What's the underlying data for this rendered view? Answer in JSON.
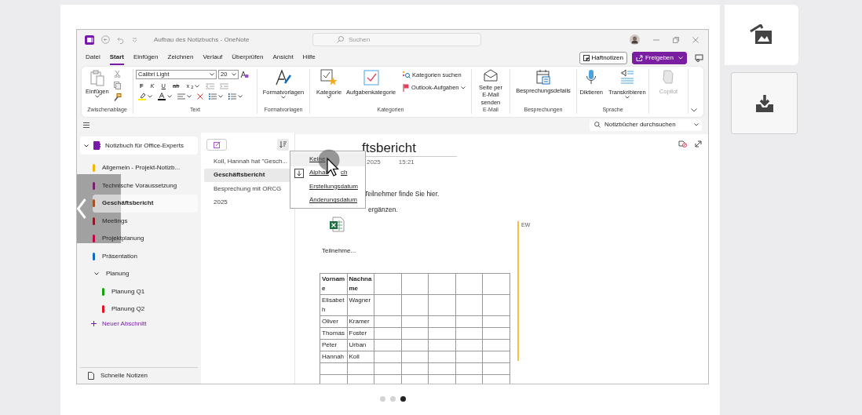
{
  "window": {
    "title": "Aufbau des Notizbuchs  -  OneNote",
    "search_placeholder": "Suchen"
  },
  "menu_tabs": [
    {
      "label": "Datei",
      "selected": false
    },
    {
      "label": "Start",
      "selected": true
    },
    {
      "label": "Einfügen",
      "selected": false
    },
    {
      "label": "Zeichnen",
      "selected": false
    },
    {
      "label": "Verlauf",
      "selected": false
    },
    {
      "label": "Überprüfen",
      "selected": false
    },
    {
      "label": "Ansicht",
      "selected": false
    },
    {
      "label": "Hilfe",
      "selected": false
    }
  ],
  "header_buttons": {
    "sticky_notes": "Haftnotizen",
    "share": "Freigeben"
  },
  "ribbon": {
    "clipboard": {
      "paste": "Einfügen",
      "label": "Zwischenablage"
    },
    "text": {
      "font": "Calibri Light",
      "size": "20",
      "bold": "F",
      "italic": "K",
      "underline": "U",
      "strikethrough": "ab",
      "subscript": "x$_{2}$",
      "label": "Text"
    },
    "styles": {
      "button": "Formatvorlagen",
      "label": "Formatvorlagen"
    },
    "tags": {
      "tag": "Kategorie",
      "todo": "Aufgabenkategorie",
      "find": "Kategorien suchen",
      "outlook": "Outlook-Aufgaben",
      "label": "Kategorien"
    },
    "email": {
      "button": "Seite per E-Mail senden",
      "label": "E-Mail"
    },
    "meetings": {
      "button": "Besprechungsdetails",
      "label": "Besprechungen"
    },
    "voice": {
      "dictate": "Diktieren",
      "transcribe": "Transkribieren",
      "label": "Sprache"
    },
    "copilot": {
      "label": "Copilot",
      "disabled": true
    }
  },
  "toolbar": {
    "search_placeholder": "Notizbücher durchsuchen"
  },
  "sidebar": {
    "notebook": "Notizbuch für Office-Experts",
    "sections": [
      {
        "label": "Allgemein - Projekt-Notizb...",
        "color": "#f4b400",
        "selected": false
      },
      {
        "label": "Technische Voraussetzung",
        "color": "#7a1f6e",
        "selected": false
      },
      {
        "label": "Geschäftsbericht",
        "color": "#a35220",
        "selected": true
      },
      {
        "label": "Meetings",
        "color": "#8c1c2c",
        "selected": false
      },
      {
        "label": "Projektplanung",
        "color": "#c8004a",
        "selected": false
      },
      {
        "label": "Präsentation",
        "color": "#0f6cbd",
        "selected": false
      },
      {
        "label": "Planung",
        "expanded": true,
        "children": [
          {
            "label": "Planung Q1",
            "color": "#13a10e",
            "selected": false
          },
          {
            "label": "Planung Q2",
            "color": "#e81123",
            "selected": false
          }
        ]
      }
    ],
    "new_section": "Neuer Abschnitt",
    "quick_notes": "Schnelle Notizen"
  },
  "pages": [
    {
      "label": "Koll, Hannah hat \"Gesch...",
      "selected": false
    },
    {
      "label": "Geschäftsbericht",
      "selected": true
    },
    {
      "label": "Besprechung mit ORCG",
      "selected": false
    },
    {
      "label": "2025",
      "selected": false
    }
  ],
  "sort_menu": [
    {
      "label": "Keine",
      "selected": true,
      "checked": false
    },
    {
      "label": "Alphab",
      "label_tail": "ch",
      "selected": false,
      "checked": true
    },
    {
      "label": "Erstellungsdatum",
      "selected": false,
      "checked": false
    },
    {
      "label": "Änderungsdatum",
      "selected": false,
      "checked": false
    }
  ],
  "page": {
    "title": "ftsbericht",
    "date": "2025",
    "time": "15:21",
    "lines": [
      "Teilnehmer finde Sie hier.",
      "ergänzen."
    ],
    "attachment": "Teilnehme...",
    "author": "EW",
    "table": {
      "rows": [
        [
          "Vorname",
          "Nachname"
        ],
        [
          "Elisabeth",
          "Wagner"
        ],
        [
          "Oliver",
          "Kramer"
        ],
        [
          "Thomas",
          "Foster"
        ],
        [
          "Peter",
          "Urban"
        ],
        [
          "Hannah",
          "Koll"
        ]
      ]
    }
  },
  "carousel": {
    "dots": [
      {
        "selected": false
      },
      {
        "selected": false
      },
      {
        "selected": true
      }
    ]
  }
}
